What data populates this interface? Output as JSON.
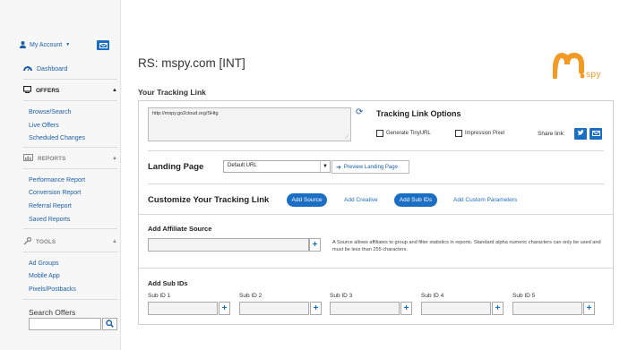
{
  "sidebar": {
    "account_label": "My Account",
    "dashboard_label": "Dashboard",
    "offers_heading": "OFFERS",
    "offers_items": [
      "Browse/Search",
      "Live Offers",
      "Scheduled Changes"
    ],
    "reports_heading": "REPORTS",
    "reports_items": [
      "Performance Report",
      "Conversion Report",
      "Referral Report",
      "Saved Reports"
    ],
    "tools_heading": "TOOLS",
    "tools_items": [
      "Ad Groups",
      "Mobile App",
      "Pixels/Postbacks"
    ],
    "search_label": "Search Offers",
    "search_value": ""
  },
  "header": {
    "title": "RS: mspy.com [INT]",
    "logo_text": "spy",
    "brand_color": "#f39a24",
    "accent_color": "#1a6fc4"
  },
  "tracking": {
    "section_title": "Your Tracking Link",
    "link_url": "http://mspy.go2cloud.org/SHtg",
    "options_title": "Tracking Link Options",
    "generate_tinyurl_label": "Generate TinyURL",
    "impression_pixel_label": "Impression Pixel",
    "share_label": "Share link:",
    "landing_page_label": "Landing Page",
    "landing_page_value": "Default URL",
    "preview_label": "Preview Landing Page",
    "customize_title": "Customize Your Tracking Link",
    "add_source_btn": "Add Source",
    "add_creative_link": "Add Creative",
    "add_subids_btn": "Add Sub IDs",
    "add_custom_params_link": "Add Custom Parameters"
  },
  "affiliate_source": {
    "heading": "Add Affiliate Source",
    "value": "",
    "note": "A Source allows affiliates to group and filter statistics in reports. Standard alpha numeric characters can only be used and must be less than 255 characters."
  },
  "sub_ids": {
    "heading": "Add Sub IDs",
    "labels": [
      "Sub ID 1",
      "Sub ID 2",
      "Sub ID 3",
      "Sub ID 4",
      "Sub ID 5"
    ]
  }
}
